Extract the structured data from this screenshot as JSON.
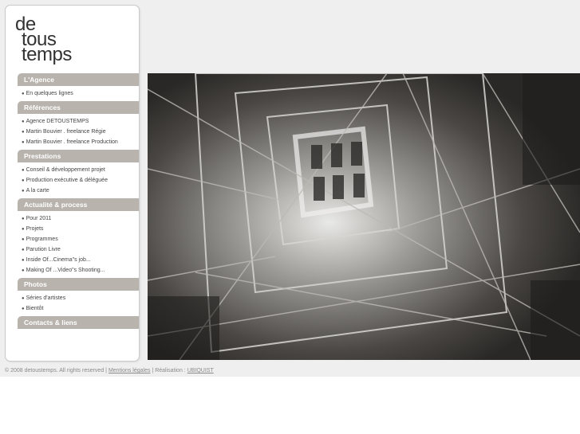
{
  "logo": {
    "line1": "de",
    "line2": "tous",
    "line3": "temps"
  },
  "nav": {
    "sections": [
      {
        "title": "L'Agence",
        "items": [
          "En quelques lignes"
        ]
      },
      {
        "title": "Références",
        "items": [
          "Agence DETOUSTEMPS",
          "Martin Bouvier . freelance Régie",
          "Martin Bouvier . freelance Production"
        ]
      },
      {
        "title": "Prestations",
        "items": [
          "Conseil & développement projet",
          "Production exécutive & déléguée",
          "A la carte"
        ]
      },
      {
        "title": "Actualité & process",
        "items": [
          "Pour 2011",
          "Projets",
          "Programmes",
          "Parution Livre",
          "Inside Of...Cinema\"s job...",
          "Making Of ...Video\"s Shooting..."
        ]
      },
      {
        "title": "Photos",
        "items": [
          "Séries d'artistes",
          "Bientôt"
        ]
      },
      {
        "title": "Contacts & liens",
        "items": []
      }
    ]
  },
  "footer": {
    "copyright": "© 2008 detoustemps. All rights reserved |",
    "mentions": "Mentions légales",
    "realisation": "| Réalisation :",
    "agency": "UBIQUIST"
  },
  "colors": {
    "section_header_bg": "#b8b3ad",
    "page_bg": "#efefef"
  }
}
